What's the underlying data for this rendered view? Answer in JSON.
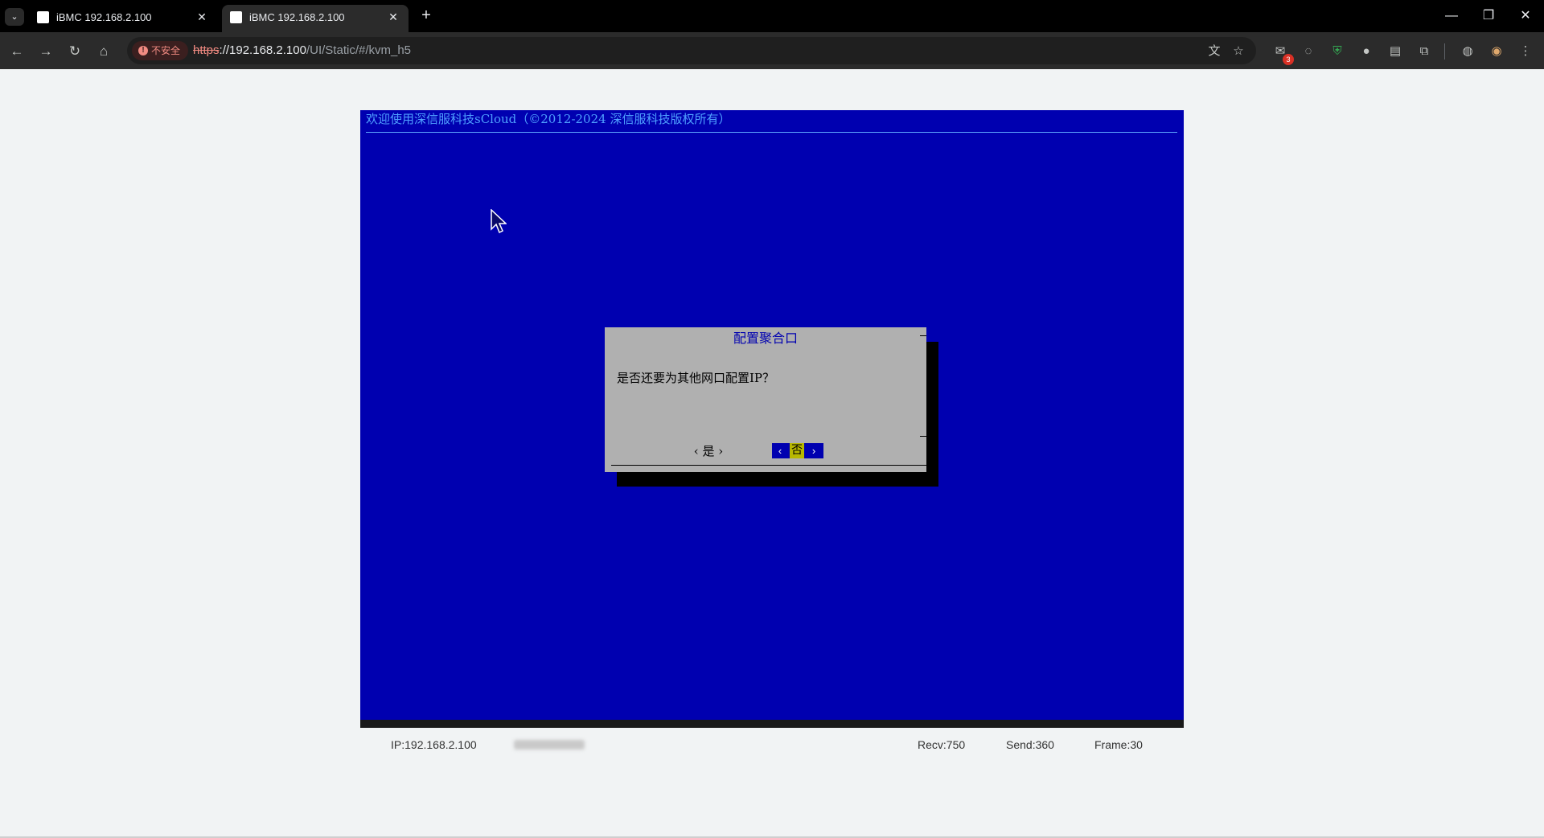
{
  "browser": {
    "tabs": [
      {
        "title": "iBMC 192.168.2.100",
        "active": false
      },
      {
        "title": "iBMC 192.168.2.100",
        "active": true
      }
    ],
    "security_chip": "不安全",
    "url": {
      "scheme": "https",
      "host": "://192.168.2.100",
      "path": "/UI/Static/#/kvm_h5"
    },
    "extension_badge": "3"
  },
  "kvm": {
    "header": "欢迎使用深信服科技sCloud（©2012-2024 深信服科技版权所有）",
    "dialog": {
      "title": "配置聚合口",
      "message": "是否还要为其他网口配置IP？",
      "yes_label": "‹  是  ›",
      "no_label": "否",
      "no_left": "‹",
      "no_right": "›"
    }
  },
  "statusbar": {
    "ip": "IP:192.168.2.100",
    "recv": "Recv:750",
    "send": "Send:360",
    "frame": "Frame:30"
  },
  "colors": {
    "kvm_bg": "#0000b0",
    "dialog_bg": "#b0b0b0",
    "focus_bg": "#b8b800"
  }
}
